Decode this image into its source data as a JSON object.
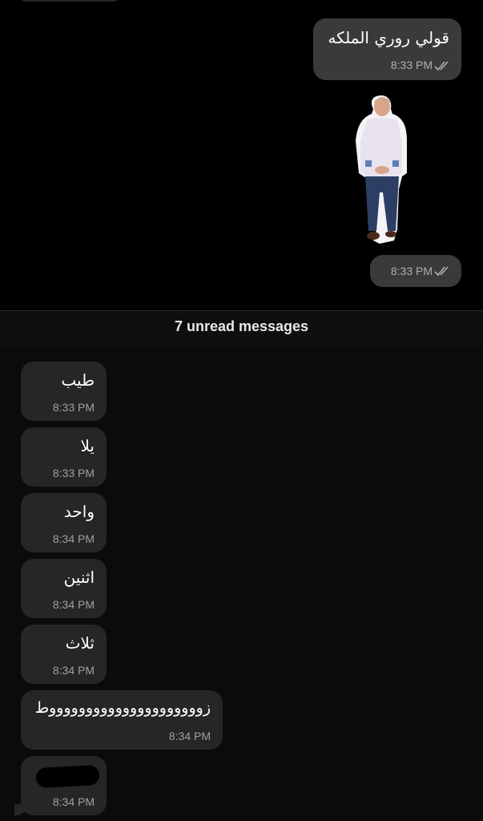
{
  "outgoing": [
    {
      "text": "قولي روري الملكه",
      "time": "8:33 PM"
    },
    {
      "text": "",
      "time": "8:33 PM"
    }
  ],
  "divider": {
    "label": "7 unread messages"
  },
  "incoming": [
    {
      "text": "طيب",
      "time": "8:33 PM"
    },
    {
      "text": "يلا",
      "time": "8:33 PM"
    },
    {
      "text": "واحد",
      "time": "8:34 PM"
    },
    {
      "text": "اثنين",
      "time": "8:34 PM"
    },
    {
      "text": "ثلاث",
      "time": "8:34 PM"
    },
    {
      "text": "زوووووووووووووووووووووط",
      "time": "8:34 PM"
    },
    {
      "text": "",
      "time": "8:34 PM"
    }
  ],
  "sticker": {
    "icon": "man-standing-sticker"
  },
  "colors": {
    "bg": "#000000",
    "bubble_out": "#3a3a3c",
    "bubble_in": "#262628"
  }
}
